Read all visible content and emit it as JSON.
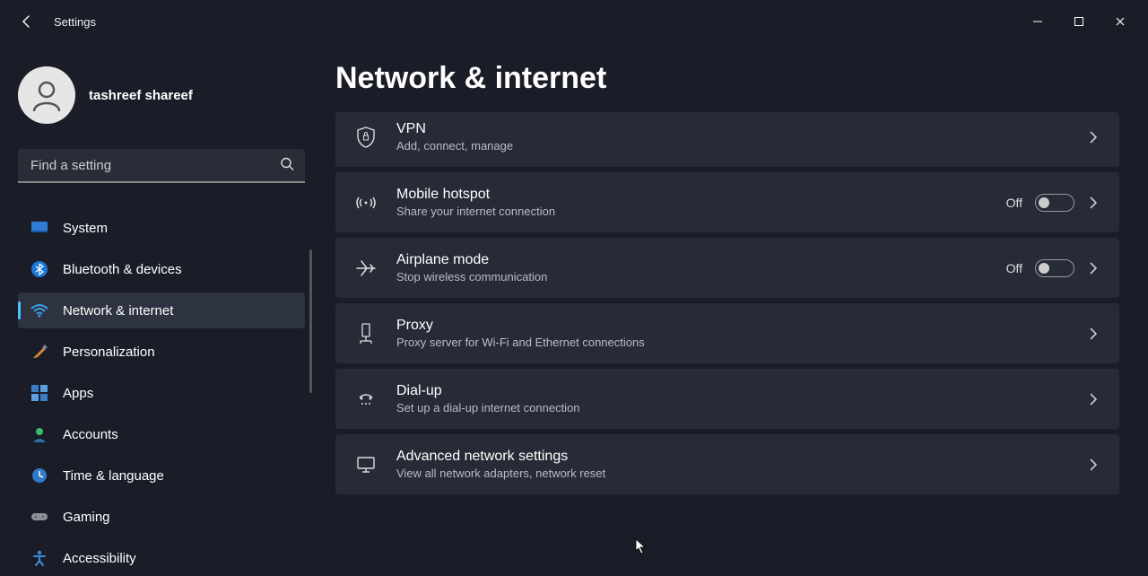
{
  "app": {
    "title": "Settings"
  },
  "user": {
    "name": "tashreef shareef"
  },
  "search": {
    "placeholder": "Find a setting"
  },
  "nav": {
    "items": [
      {
        "label": "System"
      },
      {
        "label": "Bluetooth & devices"
      },
      {
        "label": "Network & internet"
      },
      {
        "label": "Personalization"
      },
      {
        "label": "Apps"
      },
      {
        "label": "Accounts"
      },
      {
        "label": "Time & language"
      },
      {
        "label": "Gaming"
      },
      {
        "label": "Accessibility"
      }
    ],
    "active_index": 2
  },
  "page": {
    "title": "Network & internet"
  },
  "rows": [
    {
      "title": "VPN",
      "subtitle": "Add, connect, manage",
      "toggle": null
    },
    {
      "title": "Mobile hotspot",
      "subtitle": "Share your internet connection",
      "toggle": "Off"
    },
    {
      "title": "Airplane mode",
      "subtitle": "Stop wireless communication",
      "toggle": "Off"
    },
    {
      "title": "Proxy",
      "subtitle": "Proxy server for Wi-Fi and Ethernet connections",
      "toggle": null
    },
    {
      "title": "Dial-up",
      "subtitle": "Set up a dial-up internet connection",
      "toggle": null
    },
    {
      "title": "Advanced network settings",
      "subtitle": "View all network adapters, network reset",
      "toggle": null
    }
  ]
}
